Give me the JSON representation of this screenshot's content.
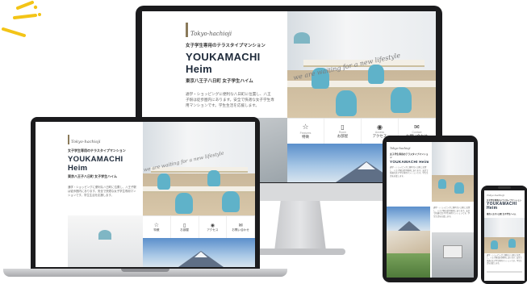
{
  "site": {
    "logo_text": "Tokyo-hachioji",
    "tagline": "女子学生専用のテラスタイプマンション",
    "name": "YOUKAMACHI Heim",
    "address": "東京八王子八日町 女子学生ハイム",
    "description": "通学・ショッピングに便利な八日町に位置し、八王子駅は徒歩圏内にあります。安全で快適な女子学生専用マンションです。学生生活を応援します。",
    "banner_script": "we are waiting for a new lifestyle",
    "nav": [
      {
        "label": "特徴",
        "en": "Features",
        "icon": "star-icon"
      },
      {
        "label": "お部屋",
        "en": "Room",
        "icon": "door-icon"
      },
      {
        "label": "アクセス",
        "en": "Access",
        "icon": "pin-icon"
      },
      {
        "label": "お問い合わせ",
        "en": "Contact",
        "icon": "mail-icon"
      }
    ]
  },
  "colors": {
    "title": "#1e2a3a",
    "chair": "#5fb2c9",
    "device_frame": "#1b1b1d",
    "ray": "#f3c417"
  }
}
